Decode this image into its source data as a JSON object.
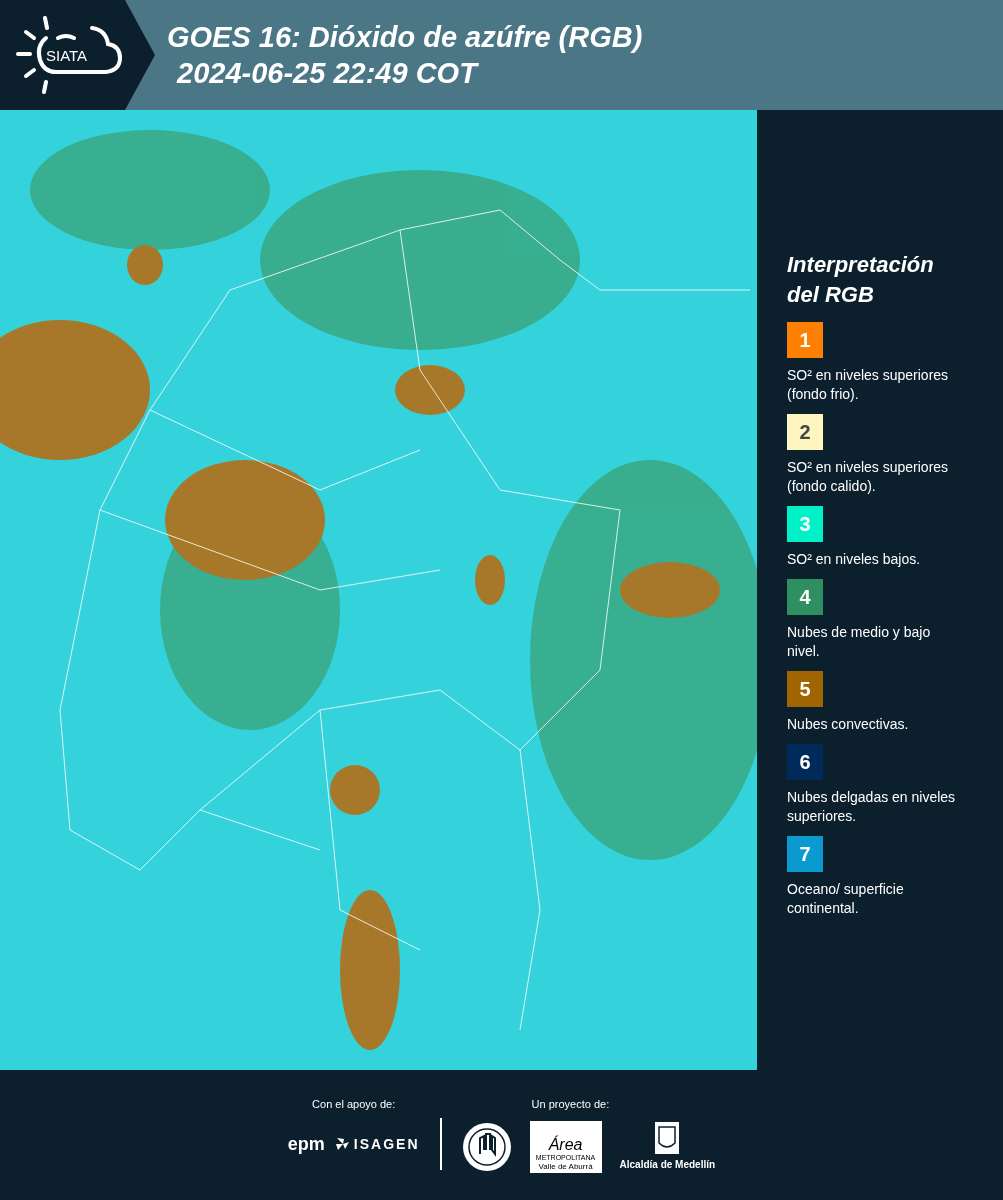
{
  "header": {
    "logo_text": "SIATA",
    "title": "GOES 16: Dióxido de azúfre (RGB)",
    "timestamp": "2024-06-25 22:49 COT"
  },
  "legend": {
    "title": "Interpretación del RGB",
    "items": [
      {
        "number": "1",
        "color": "#ff7f00",
        "text": "SO² en niveles superiores (fondo frio)."
      },
      {
        "number": "2",
        "color": "#fff5c0",
        "text": "SO² en niveles superiores (fondo calido)."
      },
      {
        "number": "3",
        "color": "#00f0c8",
        "text": "SO² en niveles bajos."
      },
      {
        "number": "4",
        "color": "#2e9060",
        "text": "Nubes de medio y bajo nivel."
      },
      {
        "number": "5",
        "color": "#a06400",
        "text": "Nubes convectivas."
      },
      {
        "number": "6",
        "color": "#002a5a",
        "text": "Nubes delgadas en niveles superiores."
      },
      {
        "number": "7",
        "color": "#0a9ad0",
        "text": "Oceano/ superficie continental."
      }
    ]
  },
  "footer": {
    "support_label": "Con el apoyo de:",
    "support_logos": [
      "epm",
      "ISAGEN"
    ],
    "project_label": "Un proyecto de:",
    "area_logo": {
      "name": "Área",
      "line1": "METROPOLITANA",
      "line2": "Valle de Aburrá"
    },
    "alcaldia_label": "Alcaldía de Medellín"
  }
}
